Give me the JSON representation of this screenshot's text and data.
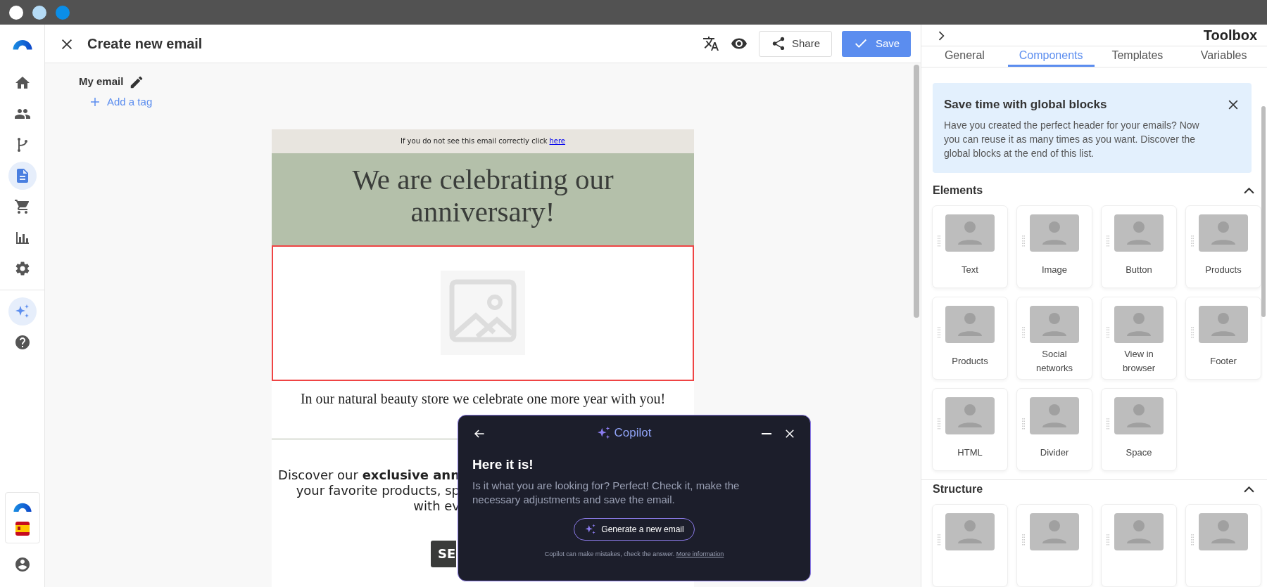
{
  "sidebar": {
    "items": [
      {
        "selected": false
      },
      {
        "selected": false
      },
      {
        "selected": false
      },
      {
        "selected": true
      },
      {
        "selected": false
      },
      {
        "selected": false
      },
      {
        "selected": false
      }
    ],
    "copilot_active": true
  },
  "header": {
    "title": "Create new email",
    "share": "Share",
    "save": "Save"
  },
  "email_meta": {
    "name": "My email",
    "add_tag": "Add a tag"
  },
  "email": {
    "preheader_text": "If you do not see this email correctly click",
    "preheader_link": "here",
    "headline": "We are celebrating our anniversary!",
    "image_selected": true,
    "intro": "In our natural beauty store we celebrate one more year with you!",
    "promo_lines": [
      "Discover our **exclusive ann**",
      "your favorite products, sp",
      "with ev"
    ],
    "cta": "SE"
  },
  "toolbox": {
    "title": "Toolbox",
    "tabs": [
      {
        "label": "General",
        "selected": false
      },
      {
        "label": "Components",
        "selected": true
      },
      {
        "label": "Templates",
        "selected": false
      },
      {
        "label": "Variables",
        "selected": false
      }
    ],
    "banner": {
      "title": "Save time with global blocks",
      "text": "Have you created the perfect header for your emails? Now you can reuse it as many times as you want. Discover the global blocks at the end of this list."
    },
    "sections": [
      {
        "title": "Elements",
        "expanded": true,
        "items": [
          {
            "kind": "block",
            "label": "Text"
          },
          {
            "kind": "block",
            "label": "Image"
          },
          {
            "kind": "block",
            "label": "Button"
          },
          {
            "kind": "block",
            "label": "Products"
          },
          {
            "kind": "block",
            "label": "Products"
          },
          {
            "kind": "block",
            "label": "Social networks"
          },
          {
            "kind": "block",
            "label": "View in browser"
          },
          {
            "kind": "block",
            "label": "Footer"
          },
          {
            "kind": "block",
            "label": "HTML"
          },
          {
            "kind": "block",
            "label": "Divider"
          },
          {
            "kind": "block",
            "label": "Space"
          }
        ]
      },
      {
        "title": "Structure",
        "expanded": true,
        "items": [
          {
            "kind": "block"
          },
          {
            "kind": "block"
          },
          {
            "kind": "block"
          },
          {
            "kind": "block"
          }
        ]
      }
    ]
  },
  "copilot": {
    "title": "Copilot",
    "heading": "Here it is!",
    "message": "Is it what you are looking for? Perfect! Check it, make the necessary adjustments and save the email.",
    "generate": "Generate a new email",
    "disclaimer": "Copilot can make mistakes, check the answer.",
    "more_link": "More information"
  }
}
